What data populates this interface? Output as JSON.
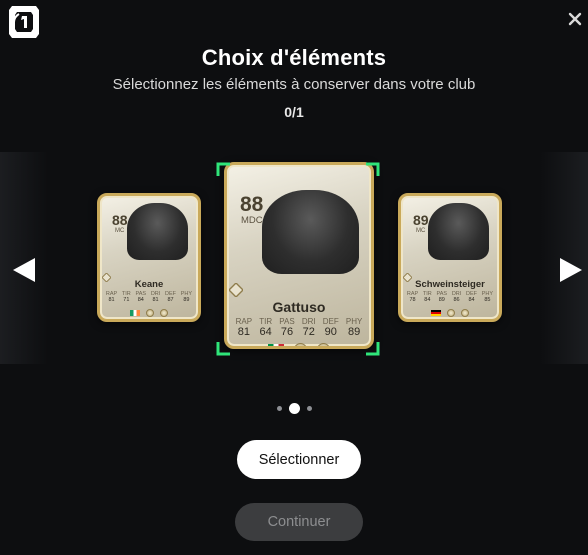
{
  "header": {
    "title": "Choix d'éléments",
    "subtitle": "Sélectionnez les éléments à conserver dans votre club",
    "counter": "0/1"
  },
  "cards": [
    {
      "name": "Keane",
      "rating": "88",
      "position": "MC",
      "nation": "Ireland",
      "stats": [
        {
          "label": "RAP",
          "value": "81"
        },
        {
          "label": "TIR",
          "value": "71"
        },
        {
          "label": "PAS",
          "value": "84"
        },
        {
          "label": "DRI",
          "value": "81"
        },
        {
          "label": "DEF",
          "value": "87"
        },
        {
          "label": "PHY",
          "value": "89"
        }
      ]
    },
    {
      "name": "Gattuso",
      "rating": "88",
      "position": "MDC",
      "nation": "Italy",
      "stats": [
        {
          "label": "RAP",
          "value": "81"
        },
        {
          "label": "TIR",
          "value": "64"
        },
        {
          "label": "PAS",
          "value": "76"
        },
        {
          "label": "DRI",
          "value": "72"
        },
        {
          "label": "DEF",
          "value": "90"
        },
        {
          "label": "PHY",
          "value": "89"
        }
      ]
    },
    {
      "name": "Schweinsteiger",
      "rating": "89",
      "position": "MC",
      "nation": "Germany",
      "stats": [
        {
          "label": "RAP",
          "value": "78"
        },
        {
          "label": "TIR",
          "value": "84"
        },
        {
          "label": "PAS",
          "value": "89"
        },
        {
          "label": "DRI",
          "value": "86"
        },
        {
          "label": "DEF",
          "value": "84"
        },
        {
          "label": "PHY",
          "value": "85"
        }
      ]
    }
  ],
  "pagination": {
    "count": 3,
    "active_index": 1
  },
  "buttons": {
    "select_label": "Sélectionner",
    "continue_label": "Continuer"
  },
  "icons": {
    "logo": "fc-logo-icon",
    "close": "close-icon",
    "prev": "arrow-left-icon",
    "next": "arrow-right-icon"
  },
  "colors": {
    "background": "#0d0e10",
    "selection_accent": "#2fe57a",
    "card_gold": "#c9a95a",
    "continue_disabled_bg": "#3c3d3f"
  }
}
